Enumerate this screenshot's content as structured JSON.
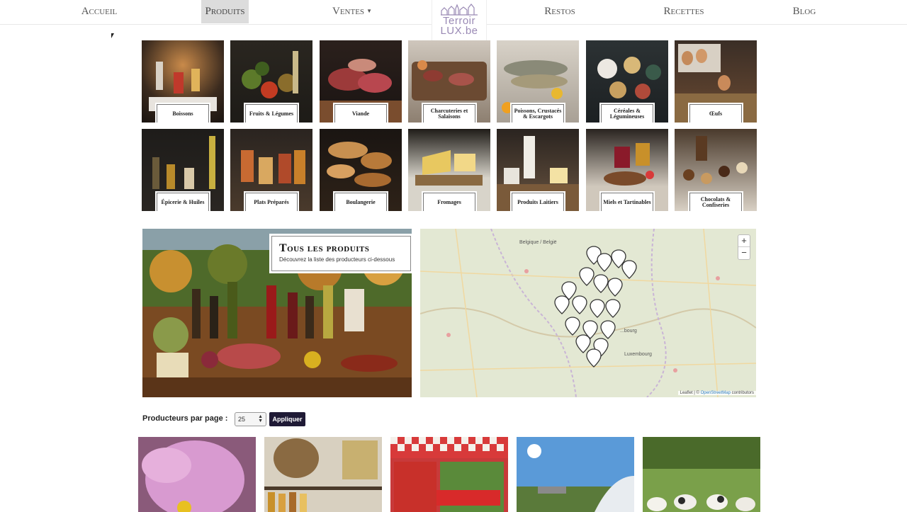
{
  "nav": {
    "accueil": "Accueil",
    "produits": "Produits",
    "ventes": "Ventes",
    "restos": "Restos",
    "recettes": "Recettes",
    "blog": "Blog",
    "logo_line1": "Terroir",
    "logo_line2": "LUX.be"
  },
  "categories": [
    {
      "label": "Boissons"
    },
    {
      "label": "Fruits & Légumes"
    },
    {
      "label": "Viande"
    },
    {
      "label": "Charcuteries et Salaisons"
    },
    {
      "label": "Poissons, Crustacés & Escargots"
    },
    {
      "label": "Céréales & Légumineuses"
    },
    {
      "label": "Œufs"
    },
    {
      "label": "Épicerie & Huiles"
    },
    {
      "label": "Plats Préparés"
    },
    {
      "label": "Boulangerie"
    },
    {
      "label": "Fromages"
    },
    {
      "label": "Produits Laitiers"
    },
    {
      "label": "Miels et Tartinables"
    },
    {
      "label": "Chocolats & Confiseries"
    }
  ],
  "banner": {
    "title": "Tous les produits",
    "subtitle": "Découvrez la liste des producteurs ci-dessous"
  },
  "map": {
    "zoom_in": "+",
    "zoom_out": "−",
    "label_belgique": "Belgique / België",
    "label_luxembourg": "Luxembourg",
    "label_burg": "...bourg",
    "attribution_leaflet": "Leaflet",
    "attribution_sep": " | © ",
    "attribution_osm": "OpenStreetMap",
    "attribution_tail": " contributors"
  },
  "pagination": {
    "per_page_label": "Producteurs par page :",
    "per_page_value": "25",
    "apply_label": "Appliquer"
  },
  "colors": {
    "nav_active_bg": "#dcdcdc",
    "apply_bg": "#1f1a35",
    "logo": "#9a8ab5"
  }
}
